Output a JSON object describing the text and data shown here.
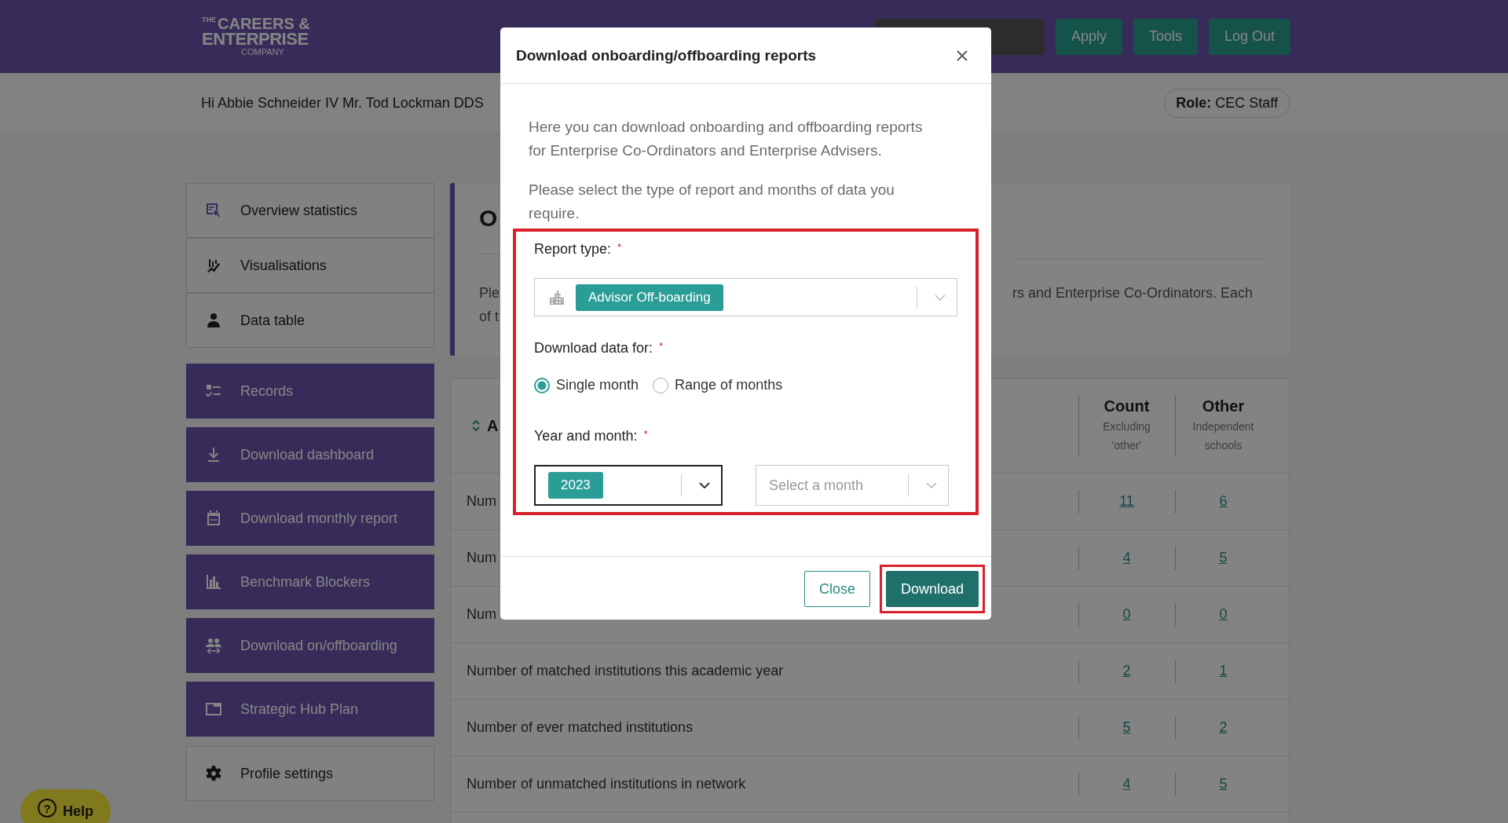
{
  "header": {
    "logo": {
      "small": "THE",
      "line1": "CAREERS &",
      "line2": "ENTERPRISE",
      "line3": "COMPANY"
    },
    "buttons": [
      "Apply",
      "Tools",
      "Log Out"
    ]
  },
  "greeting": "Hi Abbie Schneider IV Mr. Tod Lockman DDS",
  "role": {
    "label": "Role:",
    "value": "CEC Staff"
  },
  "sidebar": {
    "items": [
      {
        "label": "Overview statistics",
        "kind": "plain"
      },
      {
        "label": "Visualisations",
        "kind": "plain"
      },
      {
        "label": "Data table",
        "kind": "plain"
      },
      {
        "label": "Records",
        "kind": "primary"
      },
      {
        "label": "Download dashboard",
        "kind": "primary"
      },
      {
        "label": "Download monthly report",
        "kind": "primary"
      },
      {
        "label": "Benchmark Blockers",
        "kind": "primary"
      },
      {
        "label": "Download on/offboarding",
        "kind": "primary"
      },
      {
        "label": "Strategic Hub Plan",
        "kind": "primary"
      },
      {
        "label": "Profile settings",
        "kind": "plain"
      }
    ]
  },
  "overview": {
    "heading": "O",
    "text_left": [
      "Ple",
      "of t"
    ],
    "text_right": "rs and Enterprise Co-Ordinators. Each"
  },
  "table": {
    "title": "A",
    "columns": [
      {
        "label": "Count",
        "sublabel": "Excluding 'other'"
      },
      {
        "label": "Other",
        "sublabel": "Independent schools"
      }
    ],
    "rows": [
      {
        "label": "Num",
        "count": "11",
        "other": "6"
      },
      {
        "label": "Num",
        "count": "4",
        "other": "5"
      },
      {
        "label": "Num",
        "count": "0",
        "other": "0"
      },
      {
        "label": "Number of matched institutions this academic year",
        "count": "2",
        "other": "1"
      },
      {
        "label": "Number of ever matched institutions",
        "count": "5",
        "other": "2"
      },
      {
        "label": "Number of unmatched institutions in network",
        "count": "4",
        "other": "5"
      }
    ]
  },
  "help": {
    "icon": "?",
    "label": "Help"
  },
  "modal": {
    "title": "Download onboarding/offboarding reports",
    "paragraphs": [
      "Here you can download onboarding and offboarding reports for Enterprise Co-Ordinators and Enterprise Advisers.",
      "Please select the type of report and months of data you require."
    ],
    "form": {
      "highlighted": true,
      "report_type": {
        "label": "Report type:",
        "required_mark": "*",
        "value": "Advisor Off-boarding"
      },
      "download_for": {
        "label": "Download data for:",
        "required_mark": "*",
        "options": [
          {
            "label": "Single month",
            "selected": true
          },
          {
            "label": "Range of months",
            "selected": false
          }
        ]
      },
      "year_month": {
        "label": "Year and month:",
        "required_mark": "*",
        "year": {
          "value": "2023",
          "focused": true
        },
        "month": {
          "placeholder": "Select a month",
          "focused": false
        }
      }
    },
    "buttons": [
      {
        "label": "Close",
        "kind": "secondary",
        "highlighted": false
      },
      {
        "label": "Download",
        "kind": "primary",
        "highlighted": true
      }
    ]
  }
}
